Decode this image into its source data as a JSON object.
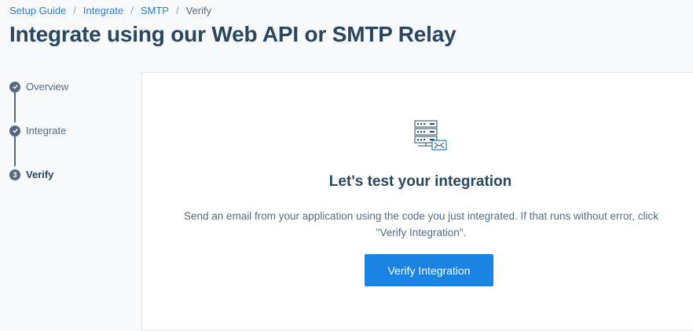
{
  "breadcrumb": {
    "items": [
      "Setup Guide",
      "Integrate",
      "SMTP"
    ],
    "current": "Verify",
    "separator": "/"
  },
  "page": {
    "title": "Integrate using our Web API or SMTP Relay"
  },
  "stepper": {
    "steps": [
      {
        "label": "Overview",
        "state": "complete"
      },
      {
        "label": "Integrate",
        "state": "complete"
      },
      {
        "label": "Verify",
        "state": "current",
        "number": "3"
      }
    ]
  },
  "card": {
    "icon": "server-mail-icon",
    "title": "Let's test your integration",
    "description": "Send an email from your application using the code you just integrated. If that runs without error, click \"Verify Integration\".",
    "button_label": "Verify Integration"
  },
  "colors": {
    "accent": "#1a82e2",
    "text_dark": "#294661",
    "text_muted": "#546b81"
  }
}
